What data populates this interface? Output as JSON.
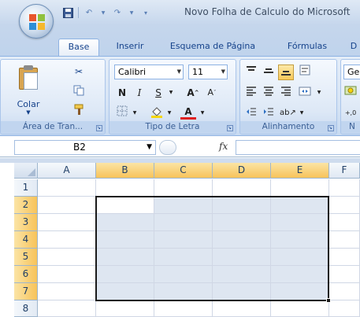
{
  "title": "Novo Folha de Calculo do Microsoft",
  "tabs": [
    "Base",
    "Inserir",
    "Esquema de Página",
    "Fórmulas",
    "D"
  ],
  "active_tab": "Base",
  "ribbon": {
    "clipboard": {
      "paste_label": "Colar",
      "group_label": "Área de Tran..."
    },
    "font": {
      "font_name": "Calibri",
      "font_size": "11",
      "bold": "N",
      "italic": "I",
      "underline": "S",
      "group_label": "Tipo de Letra"
    },
    "alignment": {
      "group_label": "Alinhamento"
    },
    "number": {
      "format_label": "Ger",
      "group_label": "N"
    }
  },
  "formula_bar": {
    "name_box": "B2",
    "fx_label": "fx",
    "formula": ""
  },
  "sheet": {
    "columns": [
      "A",
      "B",
      "C",
      "D",
      "E",
      "F"
    ],
    "rows": [
      "1",
      "2",
      "3",
      "4",
      "5",
      "6",
      "7",
      "8"
    ],
    "selected_columns": [
      "B",
      "C",
      "D",
      "E"
    ],
    "selected_rows": [
      "2",
      "3",
      "4",
      "5",
      "6",
      "7"
    ],
    "active_cell": "B2",
    "selection_range": "B2:E7"
  },
  "colors": {
    "accent": "#15428b",
    "selection_header": "#f7c35a",
    "range_fill": "#dee6f1"
  }
}
